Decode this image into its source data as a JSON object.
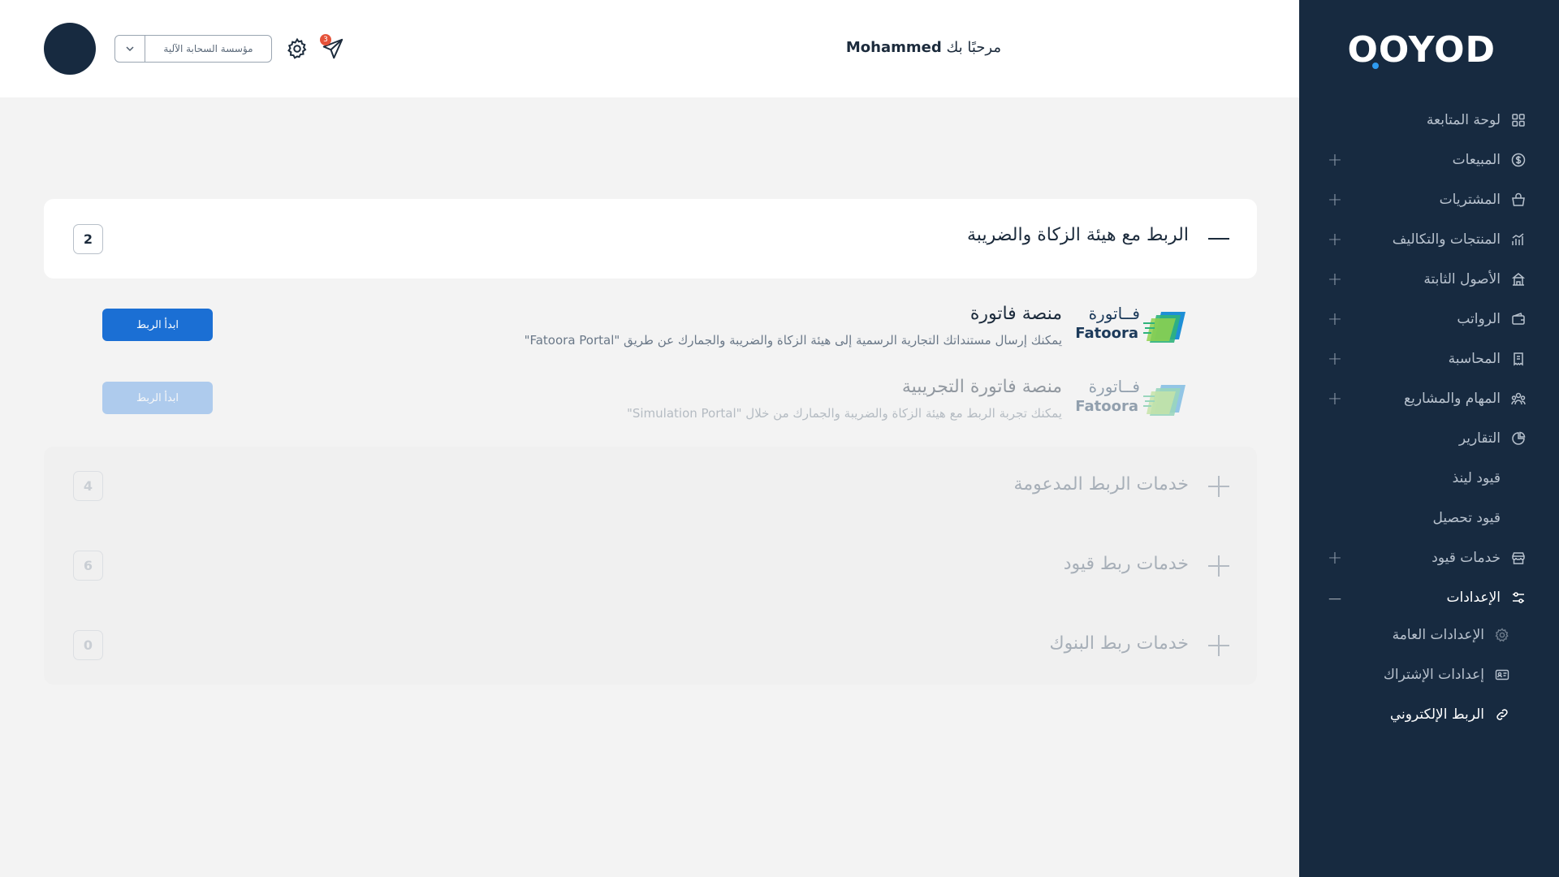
{
  "sidebar": {
    "logo": "OOYOD",
    "items": [
      {
        "label": "لوحة المتابعة",
        "icon": "grid-icon",
        "expand": ""
      },
      {
        "label": "المبيعات",
        "icon": "dollar-circle-icon",
        "expand": "+"
      },
      {
        "label": "المشتريات",
        "icon": "basket-icon",
        "expand": "+"
      },
      {
        "label": "المنتجات والتكاليف",
        "icon": "chart-bars-icon",
        "expand": "+"
      },
      {
        "label": "الأصول الثابتة",
        "icon": "building-icon",
        "expand": "+"
      },
      {
        "label": "الرواتب",
        "icon": "wallet-icon",
        "expand": "+"
      },
      {
        "label": "المحاسبة",
        "icon": "receipt-icon",
        "expand": "+"
      },
      {
        "label": "المهام والمشاريع",
        "icon": "team-icon",
        "expand": "+"
      },
      {
        "label": "التقارير",
        "icon": "pie-chart-icon",
        "expand": ""
      },
      {
        "label": "قيود لينذ",
        "icon": "",
        "expand": ""
      },
      {
        "label": "قيود تحصيل",
        "icon": "",
        "expand": ""
      },
      {
        "label": "خدمات قيود",
        "icon": "store-icon",
        "expand": "+"
      },
      {
        "label": "الإعدادات",
        "icon": "sliders-icon",
        "expand": "—"
      }
    ],
    "subitems": [
      {
        "label": "الإعدادات العامة",
        "icon": "gear-icon"
      },
      {
        "label": "إعدادات الإشتراك",
        "icon": "id-card-icon"
      },
      {
        "label": "الربط الإلكتروني",
        "icon": "link-icon"
      }
    ]
  },
  "header": {
    "welcome_prefix": "مرحبًا بك",
    "user_name": "Mohammed",
    "org_name": "مؤسسة السحابة الآلية",
    "notification_count": "3"
  },
  "panel": {
    "title": "الربط مع هيئة الزكاة والضريبة",
    "count": "2",
    "services": [
      {
        "logo_ar": "فــاتورة",
        "logo_en": "Fatoora",
        "title": "منصة فاتورة",
        "description": "يمكنك إرسال مستنداتك التجارية الرسمية إلى هيئة الزكاة والضريبة والجمارك عن طريق \"Fatoora Portal\"",
        "button": "ابدأ الربط",
        "enabled": true
      },
      {
        "logo_ar": "فــاتورة",
        "logo_en": "Fatoora",
        "title": "منصة فاتورة التجريبية",
        "description": "يمكنك تجربة الربط مع هيئة الزكاة والضريبة والجمارك من خلال \"Simulation Portal\"",
        "button": "ابدأ الربط",
        "enabled": false
      }
    ]
  },
  "groups": [
    {
      "title": "خدمات الربط المدعومة",
      "count": "4"
    },
    {
      "title": "خدمات ربط قيود",
      "count": "6"
    },
    {
      "title": "خدمات ربط البنوك",
      "count": "0"
    }
  ],
  "colors": {
    "sidebar_bg": "#172a40",
    "primary_button": "#1b6fd4",
    "badge": "#e55239"
  }
}
